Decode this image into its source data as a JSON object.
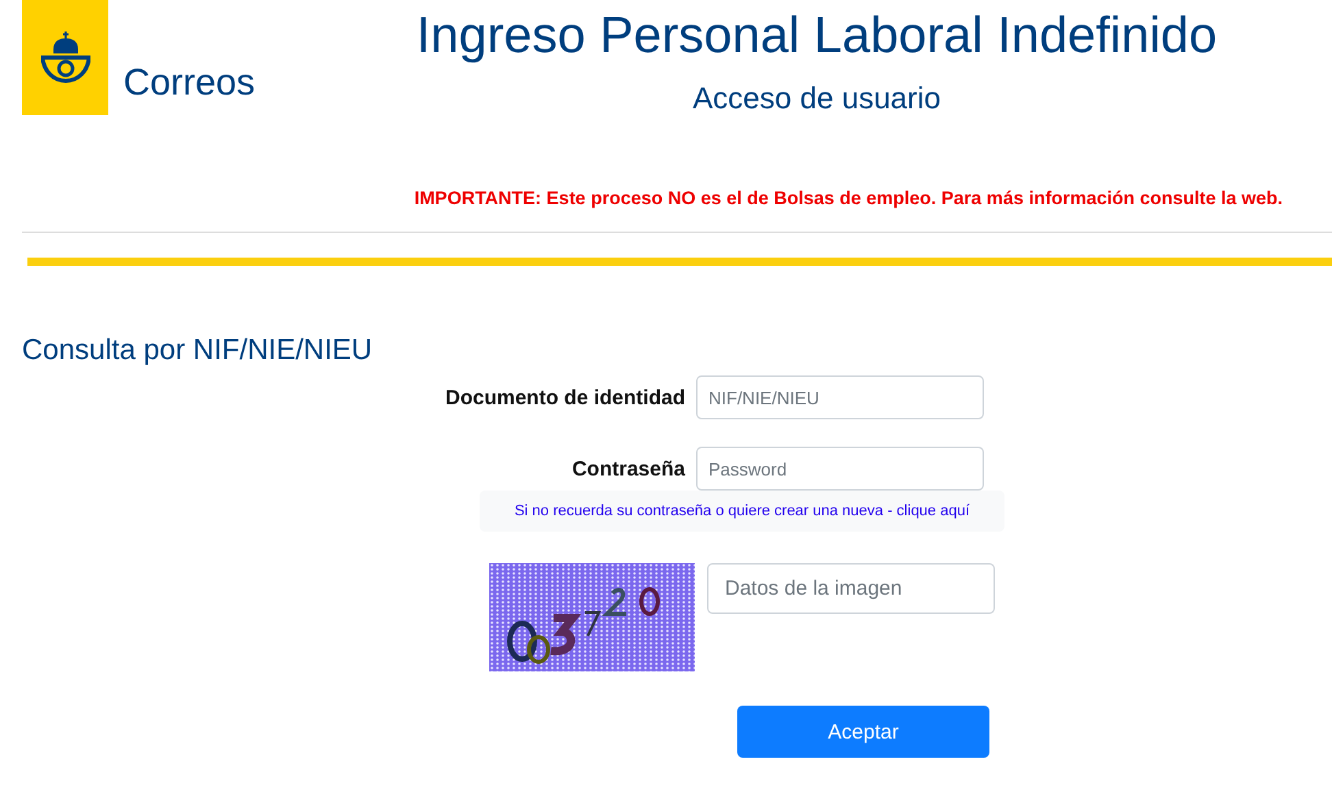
{
  "header": {
    "brand": "Correos",
    "title": "Ingreso Personal Laboral Indefinido",
    "subtitle": "Acceso de usuario",
    "notice": "IMPORTANTE: Este proceso NO es el de Bolsas de empleo. Para más información consulte la web."
  },
  "form": {
    "heading": "Consulta por NIF/NIE/NIEU",
    "fields": [
      {
        "label": "Documento de identidad",
        "placeholder": "NIF/NIE/NIEU"
      },
      {
        "label": "Contraseña",
        "placeholder": "Password"
      }
    ],
    "recover_link": "Si no recuerda su contraseña o quiere crear una nueva - clique aquí",
    "captcha": {
      "kind": "picture",
      "placeholder": "Datos de la imagen"
    },
    "submit": "Aceptar"
  }
}
